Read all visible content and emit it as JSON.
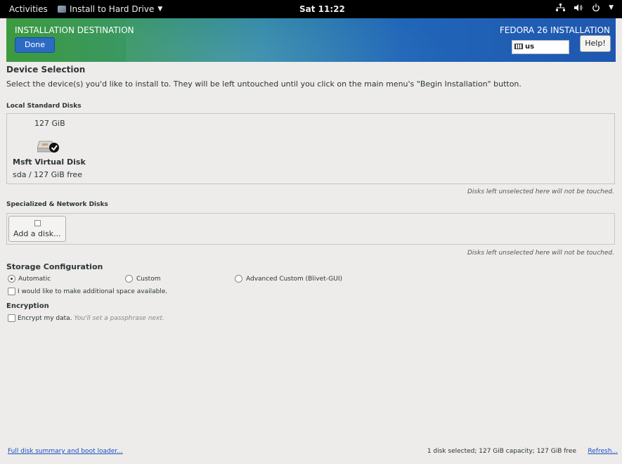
{
  "topbar": {
    "activities": "Activities",
    "app_menu": "Install to Hard Drive",
    "clock": "Sat 11:22",
    "network_icon": "network-icon",
    "volume_icon": "volume-icon",
    "power_icon": "power-icon"
  },
  "header": {
    "title": "INSTALLATION DESTINATION",
    "done_label": "Done",
    "product": "FEDORA 26 INSTALLATION",
    "keyboard_layout": "us",
    "help_label": "Help!"
  },
  "device_selection": {
    "heading": "Device Selection",
    "instructions": "Select the device(s) you'd like to install to.  They will be left untouched until you click on the main menu's \"Begin Installation\" button."
  },
  "local_disks": {
    "heading": "Local Standard Disks",
    "disks": [
      {
        "size": "127 GiB",
        "name": "Msft Virtual Disk",
        "detail": "sda / 127 GiB free",
        "selected": true
      }
    ],
    "note": "Disks left unselected here will not be touched."
  },
  "network_disks": {
    "heading": "Specialized & Network Disks",
    "add_label": "Add a disk...",
    "note": "Disks left unselected here will not be touched."
  },
  "storage": {
    "heading": "Storage Configuration",
    "options": [
      "Automatic",
      "Custom",
      "Advanced Custom (Blivet-GUI)"
    ],
    "selected": "Automatic",
    "reclaim_label": "I would like to make additional space available."
  },
  "encryption": {
    "heading": "Encryption",
    "encrypt_label": "Encrypt my data.",
    "encrypt_hint": "You'll set a passphrase next."
  },
  "footer": {
    "summary_link": "Full disk summary and boot loader...",
    "status": "1 disk selected; 127 GiB capacity; 127 GiB free",
    "refresh_link": "Refresh..."
  }
}
